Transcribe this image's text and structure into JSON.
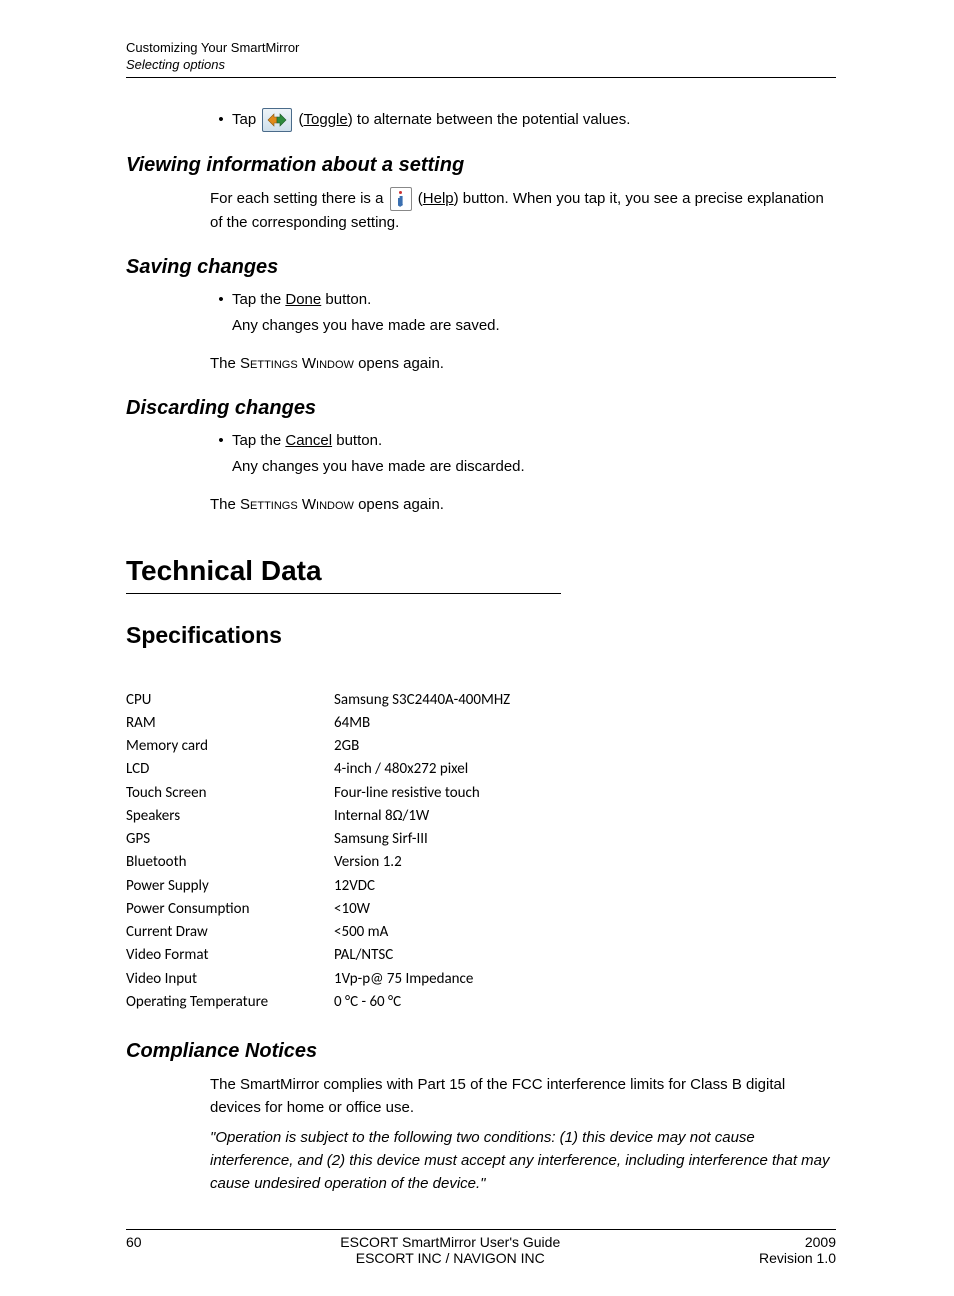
{
  "header": {
    "line1": "Customizing Your SmartMirror",
    "line2": "Selecting options"
  },
  "toggle": {
    "pre": "Tap ",
    "label": "Toggle",
    "post": " to alternate between the potential values."
  },
  "viewing": {
    "heading": "Viewing information about a setting",
    "p_pre": "For each setting there is a ",
    "p_label": "Help",
    "p_mid": " button. When you tap it, you see a precise explanation of the corresponding setting."
  },
  "saving": {
    "heading": "Saving changes",
    "b1_pre": "Tap the ",
    "b1_u": "Done",
    "b1_post": " button.",
    "b1_follow": "Any changes you have made are saved.",
    "after_pre": "The ",
    "after_sw": "Settings Window",
    "after_post": " opens again."
  },
  "discarding": {
    "heading": "Discarding changes",
    "b1_pre": "Tap the ",
    "b1_u": "Cancel",
    "b1_post": " button.",
    "b1_follow": "Any changes you have made are discarded.",
    "after_pre": "The ",
    "after_sw": "Settings Window",
    "after_post": " opens again."
  },
  "tech": {
    "h1": "Technical Data",
    "h2": "Specifications"
  },
  "specs": [
    {
      "label": "CPU",
      "value": "Samsung S3C2440A-400MHZ"
    },
    {
      "label": "RAM",
      "value": "64MB"
    },
    {
      "label": "Memory card",
      "value": "2GB"
    },
    {
      "label": "LCD",
      "value": "4-inch / 480x272 pixel"
    },
    {
      "label": "Touch Screen",
      "value": "Four-line resistive touch"
    },
    {
      "label": "Speakers",
      "value": "Internal 8Ω/1W"
    },
    {
      "label": "GPS",
      "value": "Samsung Sirf-III"
    },
    {
      "label": "Bluetooth",
      "value": "Version 1.2"
    },
    {
      "label": "Power Supply",
      "value": "12VDC"
    },
    {
      "label": "Power Consumption",
      "value": "<10W"
    },
    {
      "label": "Current Draw",
      "value": "<500 mA"
    },
    {
      "label": "Video Format",
      "value": "PAL/NTSC"
    },
    {
      "label": "Video Input",
      "value": "1Vp-p@ 75 Impedance"
    },
    {
      "label": "Operating Temperature",
      "value": "0 °C - 60 °C"
    }
  ],
  "compliance": {
    "heading": "Compliance Notices",
    "p1": "The SmartMirror complies with Part 15 of the FCC interference limits for Class B digital devices for home or office use.",
    "p2": "\"Operation is subject to the following two conditions: (1) this device may not cause interference, and (2) this device must accept any interference, including interference that may cause undesired operation of the device.\""
  },
  "footer": {
    "page": "60",
    "center1": "ESCORT SmartMirror User's Guide",
    "center2": "ESCORT INC / NAVIGON INC",
    "right1": "2009",
    "right2": "Revision 1.0"
  }
}
